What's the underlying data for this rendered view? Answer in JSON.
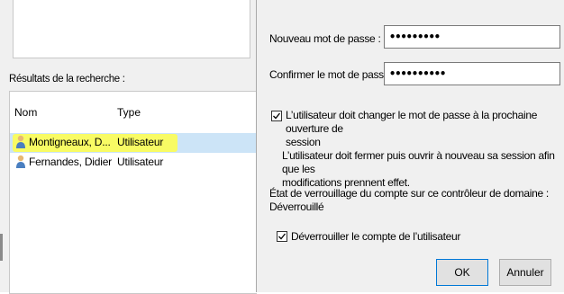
{
  "search": {
    "results_label": "Résultats de la recherche :",
    "columns": {
      "name": "Nom",
      "type": "Type"
    },
    "rows": [
      {
        "name": "Montigneaux, D...",
        "type": "Utilisateur"
      },
      {
        "name": "Fernandes, Didier",
        "type": "Utilisateur"
      }
    ]
  },
  "reset": {
    "new_password_label": "Nouveau mot de passe :",
    "new_password_value": "•••••••••",
    "confirm_password_label": "Confirmer le mot de passe :",
    "confirm_password_value": "••••••••••",
    "must_change": {
      "checked": true,
      "line1": "L’utilisateur doit changer le mot de passe à la prochaine ouverture de",
      "line2": "session"
    },
    "note_line1": "L’utilisateur doit fermer puis ouvrir à nouveau sa session afin que les",
    "note_line2": "modifications prennent effet.",
    "lock_status": "État de verrouillage du compte sur ce contrôleur de domaine : Déverrouillé",
    "unlock": {
      "checked": true,
      "label": "Déverrouiller le compte de l’utilisateur"
    },
    "ok_label": "OK",
    "cancel_label": "Annuler"
  },
  "colors": {
    "selection": "#cce4f7",
    "highlight": "#ffff4a",
    "user_icon_body": "#4a7fc0",
    "user_icon_head": "#e7b873"
  }
}
